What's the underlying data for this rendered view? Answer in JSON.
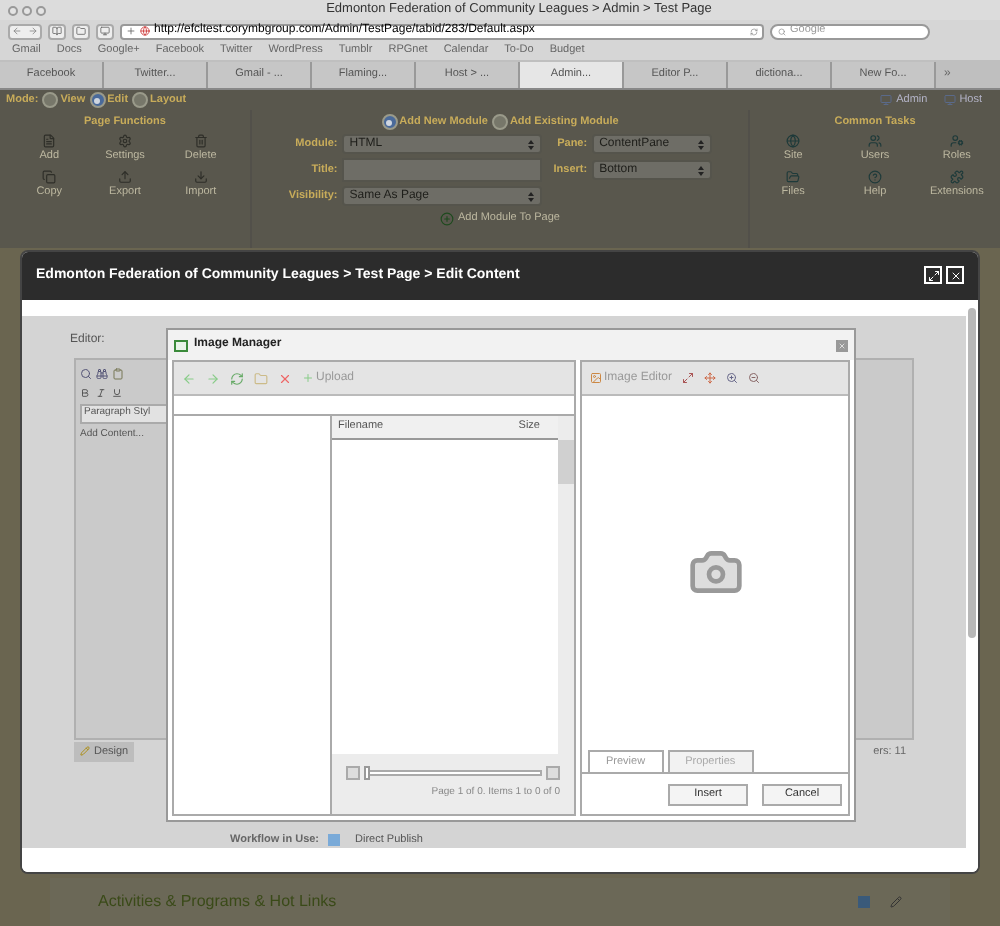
{
  "browser": {
    "title": "Edmonton Federation of Community Leagues > Admin > Test Page",
    "url": "http://efcltest.corymbgroup.com/Admin/TestPage/tabid/283/Default.aspx",
    "search_placeholder": "Google",
    "bookmarks": [
      "Gmail",
      "Docs",
      "Google+",
      "Facebook",
      "Twitter",
      "WordPress",
      "Tumblr",
      "RPGnet",
      "Calendar",
      "To-Do",
      "Budget"
    ],
    "tabs": [
      {
        "label": "Facebook",
        "selected": false
      },
      {
        "label": "Twitter...",
        "selected": false
      },
      {
        "label": "Gmail - ...",
        "selected": false
      },
      {
        "label": "Flaming...",
        "selected": false
      },
      {
        "label": "Host > ...",
        "selected": false
      },
      {
        "label": "Admin...",
        "selected": true
      },
      {
        "label": "Editor P...",
        "selected": false
      },
      {
        "label": "dictiona...",
        "selected": false
      },
      {
        "label": "New Fo...",
        "selected": false
      }
    ],
    "tabs_more": "»"
  },
  "control_panel": {
    "mode_label": "Mode:",
    "modes": [
      {
        "label": "View",
        "selected": false
      },
      {
        "label": "Edit",
        "selected": true
      },
      {
        "label": "Layout",
        "selected": false
      }
    ],
    "links": [
      "Admin",
      "Host"
    ],
    "page_functions": {
      "title": "Page Functions",
      "items": [
        "Add",
        "Settings",
        "Delete",
        "Copy",
        "Export",
        "Import"
      ]
    },
    "module_options": [
      {
        "label": "Add New Module",
        "selected": true
      },
      {
        "label": "Add Existing Module",
        "selected": false
      }
    ],
    "fields_left": [
      {
        "label": "Module:",
        "kind": "select",
        "value": "HTML"
      },
      {
        "label": "Title:",
        "kind": "text"
      },
      {
        "label": "Visibility:",
        "kind": "select",
        "value": "Same As Page"
      }
    ],
    "fields_right": [
      {
        "label": "Pane:",
        "kind": "select",
        "value": "ContentPane"
      },
      {
        "label": "Insert:",
        "kind": "select",
        "value": "Bottom"
      }
    ],
    "add_module": "Add Module To Page",
    "common_tasks": {
      "title": "Common Tasks",
      "items": [
        "Site",
        "Users",
        "Roles",
        "Files",
        "Help",
        "Extensions"
      ]
    }
  },
  "modal": {
    "title": "Edmonton Federation of Community Leagues > Test Page > Edit Content",
    "editor_label": "Editor:",
    "paragraph_style": "Paragraph Styl",
    "content_placeholder": "Add Content...",
    "design_tab": "Design",
    "word_count": "ers: 11",
    "workflow_label": "Workflow in Use:",
    "workflow": "Direct Publish"
  },
  "image_manager": {
    "title": "Image Manager",
    "upload": "Upload",
    "columns": [
      "Filename",
      "Size"
    ],
    "pager": "Page 1 of 0. Items 1 to 0 of 0",
    "pager_slider": {
      "level": 0
    },
    "image_editor": "Image Editor",
    "tabs": [
      {
        "label": "Preview",
        "selected": true
      },
      {
        "label": "Properties",
        "selected": false
      }
    ],
    "buttons": [
      "Insert",
      "Cancel"
    ]
  },
  "page": {
    "heading": "Activities & Programs & Hot Links"
  }
}
